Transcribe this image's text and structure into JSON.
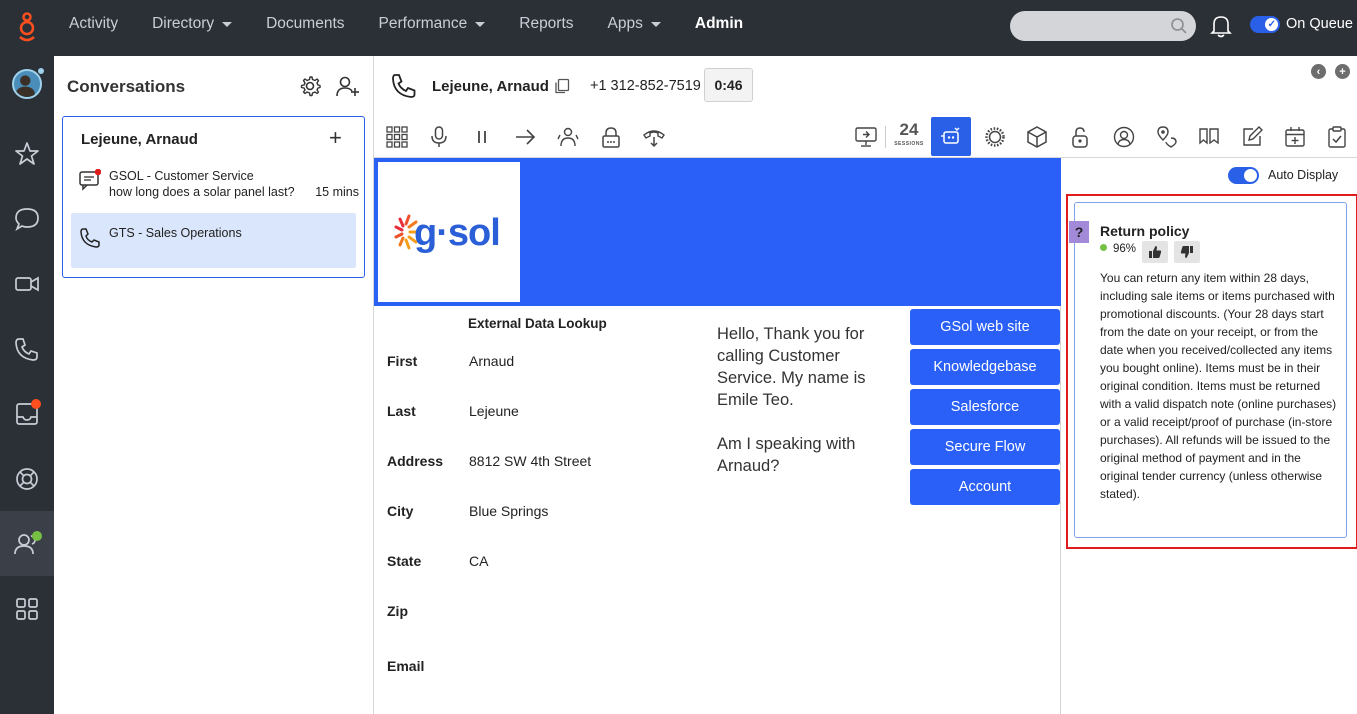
{
  "nav": {
    "items": [
      "Activity",
      "Directory",
      "Documents",
      "Performance",
      "Reports",
      "Apps",
      "Admin"
    ],
    "status_label": "On Queue"
  },
  "conversations": {
    "title": "Conversations",
    "contact_name": "Lejeune, Arnaud",
    "threads": [
      {
        "title": "GSOL - Customer Service",
        "subtitle": "how long does a solar panel last?",
        "time": "15 mins"
      },
      {
        "title": "GTS - Sales Operations"
      }
    ]
  },
  "interaction": {
    "name": "Lejeune, Arnaud",
    "phone": "+1 312-852-7519",
    "timer": "0:46",
    "sessions_badge": "24",
    "sessions_small": "SESSIONS"
  },
  "script": {
    "logo_text": "g·sol",
    "lookup_title": "External Data Lookup",
    "fields": [
      {
        "label": "First",
        "value": "Arnaud"
      },
      {
        "label": "Last",
        "value": "Lejeune"
      },
      {
        "label": "Address",
        "value": "8812 SW 4th Street"
      },
      {
        "label": "City",
        "value": "Blue Springs"
      },
      {
        "label": "State",
        "value": "CA"
      },
      {
        "label": "Zip",
        "value": ""
      },
      {
        "label": "Email",
        "value": ""
      }
    ],
    "speech_line1": "Hello, Thank you for calling Customer Service. My name is Emile Teo.",
    "speech_line2": "Am I speaking with Arnaud?",
    "buttons": [
      "GSol web site",
      "Knowledgebase",
      "Salesforce",
      "Secure Flow",
      "Account"
    ]
  },
  "knowledge": {
    "auto_display_label": "Auto Display",
    "card_title": "Return policy",
    "confidence": "96%",
    "body": "You can return any item within 28 days, including sale items or items purchased with promotional discounts. (Your 28 days start from the date on your receipt, or from the date when you received/collected any items you bought online). Items must be in their original condition. Items must be returned with a valid dispatch note (online purchases) or a valid receipt/proof of purchase (in-store purchases). All refunds will be issued to the original method of payment and in the original tender currency (unless otherwise stated)."
  },
  "colors": {
    "nav_bg": "#2b3037",
    "accent": "#2a60e8",
    "banner": "#2a60f8",
    "highlight": "#e01b1b",
    "selected_thread": "#d9e6fb"
  }
}
